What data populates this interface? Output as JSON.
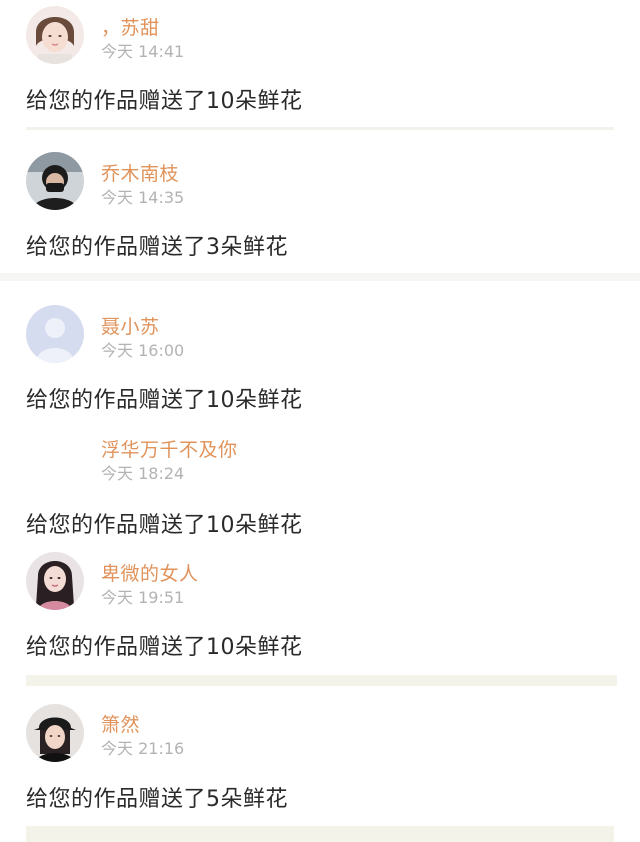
{
  "feed": [
    {
      "name": "，苏甜",
      "time": "今天 14:41",
      "message": "给您的作品赠送了10朵鲜花",
      "avatar": "girl-avatar-icon"
    },
    {
      "name": "乔木南枝",
      "time": "今天 14:35",
      "message": "给您的作品赠送了3朵鲜花",
      "avatar": "boy-avatar-icon"
    },
    {
      "name": "聂小苏",
      "time": "今天 16:00",
      "message": "给您的作品赠送了10朵鲜花",
      "avatar": "default-avatar-icon"
    },
    {
      "name": "浮华万千不及你",
      "time": "今天 18:24",
      "message": "给您的作品赠送了10朵鲜花",
      "avatar": ""
    },
    {
      "name": "卑微的女人",
      "time": "今天 19:51",
      "message": "给您的作品赠送了10朵鲜花",
      "avatar": "woman-avatar-icon"
    },
    {
      "name": "箫然",
      "time": "今天 21:16",
      "message": "给您的作品赠送了5朵鲜花",
      "avatar": "cap-avatar-icon"
    }
  ],
  "colors": {
    "name": "#e0935b",
    "time": "#b3b3b3",
    "message": "#2a2a2a",
    "divider": "#f4f3ea"
  }
}
